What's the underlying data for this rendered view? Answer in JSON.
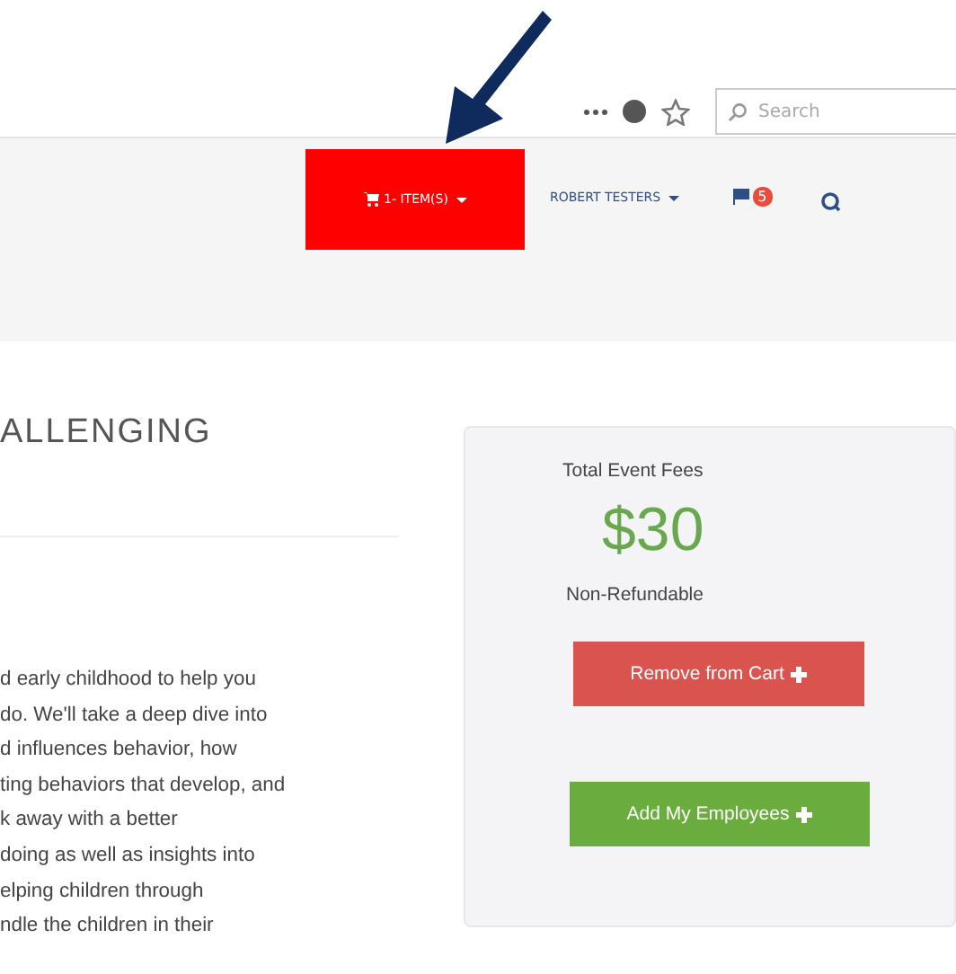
{
  "browser_toolbar": {
    "search": {
      "placeholder": "Search"
    }
  },
  "nav": {
    "cart": {
      "label": "1- ITEM(S)"
    },
    "user": {
      "label": "ROBERT TESTERS"
    },
    "flag_badge": "5"
  },
  "heading": "ALLENGING",
  "description_lines": [
    "d early childhood to help you",
    "do. We'll take a deep dive into",
    "d influences behavior, how",
    "ting behaviors that develop, and",
    "k away with a better",
    "doing as well as insights into",
    "elping children through",
    "ndle the children in their"
  ],
  "fees_card": {
    "title": "Total Event Fees",
    "price": "$30",
    "note": "Non-Refundable",
    "buttons": [
      {
        "label": "Remove from Cart",
        "kind": "danger"
      },
      {
        "label": "Add My Employees",
        "kind": "success"
      }
    ]
  }
}
